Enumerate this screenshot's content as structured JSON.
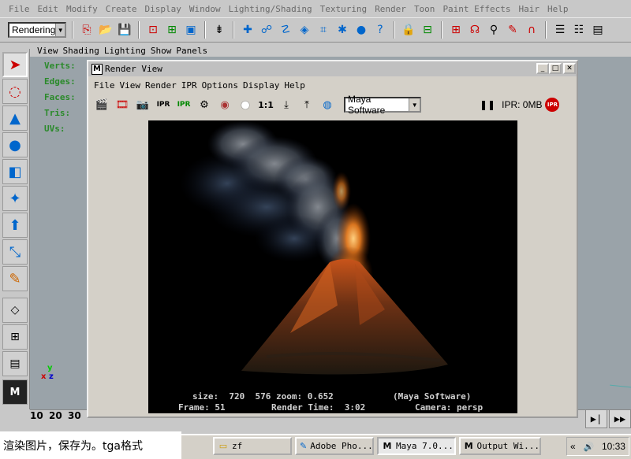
{
  "main_menu": [
    "File",
    "Edit",
    "Modify",
    "Create",
    "Display",
    "Window",
    "Lighting/Shading",
    "Texturing",
    "Render",
    "Toon",
    "Paint Effects",
    "Hair",
    "Help"
  ],
  "status_line": {
    "mode": "Rendering",
    "icons": [
      "open-scene-icon",
      "save-scene-icon",
      "select-hierarchy-icon",
      "select-object-icon",
      "select-component-icon",
      "input-output-icon",
      "snap-grid-icon",
      "snap-curve-icon",
      "snap-point-icon",
      "snap-plane-icon",
      "make-live-icon",
      "history-icon",
      "render-frame-icon",
      "ipr-render-icon",
      "render-globals-icon"
    ]
  },
  "panel_menu": [
    "View",
    "Shading",
    "Lighting",
    "Show",
    "Panels"
  ],
  "hud": {
    "verts": "Verts:",
    "edges": "Edges:",
    "faces": "Faces:",
    "tris": "Tris:",
    "uvs": "UVs:"
  },
  "axis": {
    "y": "y",
    "x": "x",
    "z": "z"
  },
  "time_slider": {
    "ticks": [
      "10",
      "20",
      "30"
    ]
  },
  "render_view": {
    "title": "Render View",
    "menu": [
      "File",
      "View",
      "Render",
      "IPR",
      "Options",
      "Display",
      "Help"
    ],
    "renderer": "Maya Software",
    "ipr_memory": "IPR: 0MB",
    "zoom_label": "1:1",
    "stats": {
      "size_line": "size:  720  576 zoom: 0.652",
      "renderer_note": "(Maya Software)",
      "frame": "Frame: 51",
      "render_time": "Render Time:  3:02",
      "camera": "Camera: persp"
    }
  },
  "caption": "渲染图片，保存为。tga格式",
  "taskbar": {
    "buttons": [
      {
        "label": "zf",
        "icon": "folder-icon"
      },
      {
        "label": "Adobe Pho...",
        "icon": "photoshop-icon"
      },
      {
        "label": "Maya 7.0...",
        "icon": "maya-icon",
        "active": true
      },
      {
        "label": "Output Wi...",
        "icon": "maya-icon"
      }
    ],
    "clock": "10:33",
    "tray_arrows": "«"
  }
}
